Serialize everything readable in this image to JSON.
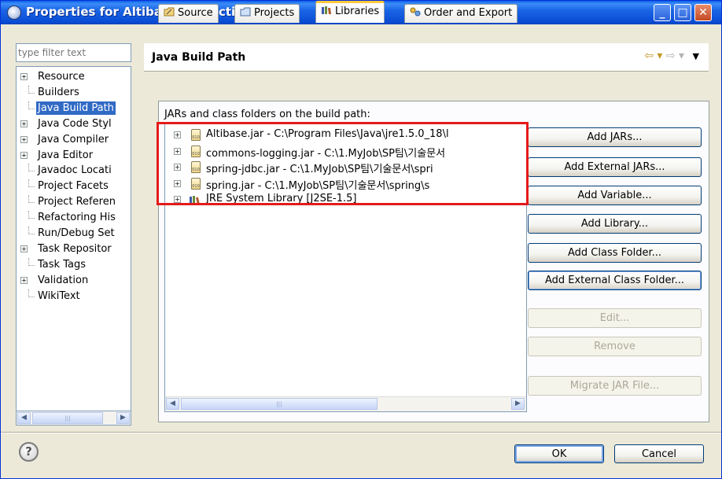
{
  "window": {
    "title": "Properties for AltibaseConnectionPool",
    "minimize": "_",
    "maximize": "□",
    "close": "✕"
  },
  "filter": {
    "placeholder": "type filter text"
  },
  "nav": {
    "items": [
      {
        "label": "Resource",
        "expandable": true,
        "selected": false
      },
      {
        "label": "Builders",
        "expandable": false,
        "selected": false
      },
      {
        "label": "Java Build Path",
        "expandable": false,
        "selected": true
      },
      {
        "label": "Java Code Styl",
        "expandable": true,
        "selected": false
      },
      {
        "label": "Java Compiler",
        "expandable": true,
        "selected": false
      },
      {
        "label": "Java Editor",
        "expandable": true,
        "selected": false
      },
      {
        "label": "Javadoc Locati",
        "expandable": false,
        "selected": false
      },
      {
        "label": "Project Facets",
        "expandable": false,
        "selected": false
      },
      {
        "label": "Project Referen",
        "expandable": false,
        "selected": false
      },
      {
        "label": "Refactoring His",
        "expandable": false,
        "selected": false
      },
      {
        "label": "Run/Debug Set",
        "expandable": false,
        "selected": false
      },
      {
        "label": "Task Repositor",
        "expandable": true,
        "selected": false
      },
      {
        "label": "Task Tags",
        "expandable": false,
        "selected": false
      },
      {
        "label": "Validation",
        "expandable": true,
        "selected": false
      },
      {
        "label": "WikiText",
        "expandable": false,
        "selected": false
      }
    ]
  },
  "page": {
    "title": "Java Build Path"
  },
  "tabs": [
    {
      "label": "Source",
      "icon": "source-folder-icon",
      "active": false
    },
    {
      "label": "Projects",
      "icon": "projects-icon",
      "active": false
    },
    {
      "label": "Libraries",
      "icon": "libraries-icon",
      "active": true
    },
    {
      "label": "Order and Export",
      "icon": "order-export-icon",
      "active": false
    }
  ],
  "libraries": {
    "section_label": "JARs and class folders on the build path:",
    "entries": [
      {
        "label": "Altibase.jar - C:\\Program Files\\Java\\jre1.5.0_18\\l",
        "icon": "jar-icon"
      },
      {
        "label": "commons-logging.jar - C:\\1.MyJob\\SP팀\\기술문서",
        "icon": "jar-icon"
      },
      {
        "label": "spring-jdbc.jar - C:\\1.MyJob\\SP팀\\기술문서\\spri",
        "icon": "jar-icon"
      },
      {
        "label": "spring.jar - C:\\1.MyJob\\SP팀\\기술문서\\spring\\s",
        "icon": "jar-icon"
      },
      {
        "label": "JRE System Library [J2SE-1.5]",
        "icon": "library-icon"
      }
    ]
  },
  "buttons": {
    "add_jars": "Add JARs...",
    "add_external_jars": "Add External JARs...",
    "add_variable": "Add Variable...",
    "add_library": "Add Library...",
    "add_class_folder": "Add Class Folder...",
    "add_external_class_folder": "Add External Class Folder...",
    "edit": "Edit...",
    "remove": "Remove",
    "migrate_jar": "Migrate JAR File..."
  },
  "footer": {
    "help": "?",
    "ok": "OK",
    "cancel": "Cancel"
  },
  "colors": {
    "highlight_box": "#e51a1a",
    "selection": "#316ac5",
    "title_bar": "#0a5fe8"
  }
}
